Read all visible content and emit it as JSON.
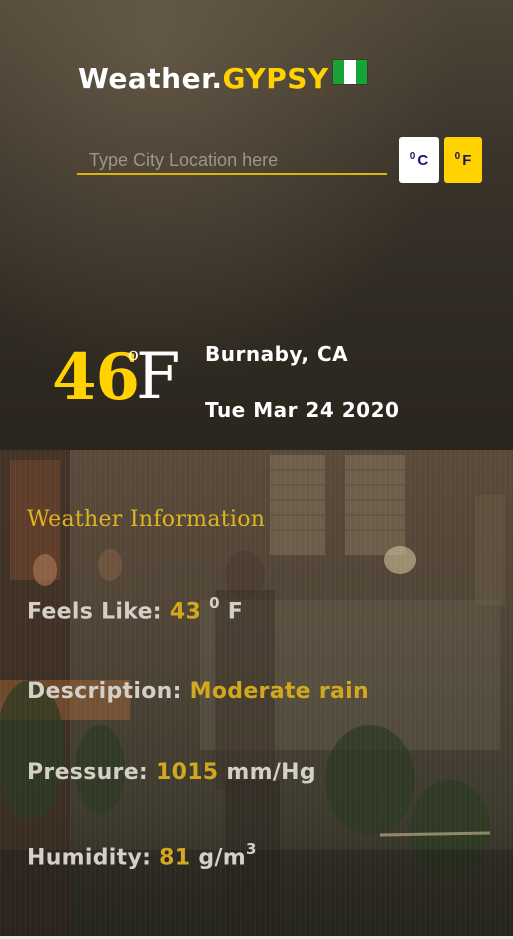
{
  "header": {
    "brand_main": "Weather.",
    "brand_accent": "GYPSY",
    "flag_icon": "nigeria-flag-icon"
  },
  "search": {
    "placeholder": "Type City Location here",
    "value": ""
  },
  "units": {
    "celsius_sup": "0",
    "celsius_label": "C",
    "fahrenheit_sup": "0",
    "fahrenheit_label": "F"
  },
  "current": {
    "temperature": "46",
    "degree_symbol": "o",
    "unit": "F",
    "location": "Burnaby, CA",
    "date": "Tue Mar 24 2020"
  },
  "info": {
    "title": "Weather Information",
    "feels_like_label": "Feels Like:",
    "feels_like_value": "43",
    "feels_like_sup": "0",
    "feels_like_unit": "F",
    "description_label": "Description:",
    "description_value": "Moderate rain",
    "pressure_label": "Pressure:",
    "pressure_value": "1015",
    "pressure_unit": "mm/Hg",
    "humidity_label": "Humidity:",
    "humidity_value": "81",
    "humidity_unit": "g/m",
    "humidity_sup": "3"
  },
  "colors": {
    "accent": "#ffd200",
    "value_gold": "#d2a91e",
    "button_text": "#1b1464",
    "flag_green": "#18a337"
  }
}
